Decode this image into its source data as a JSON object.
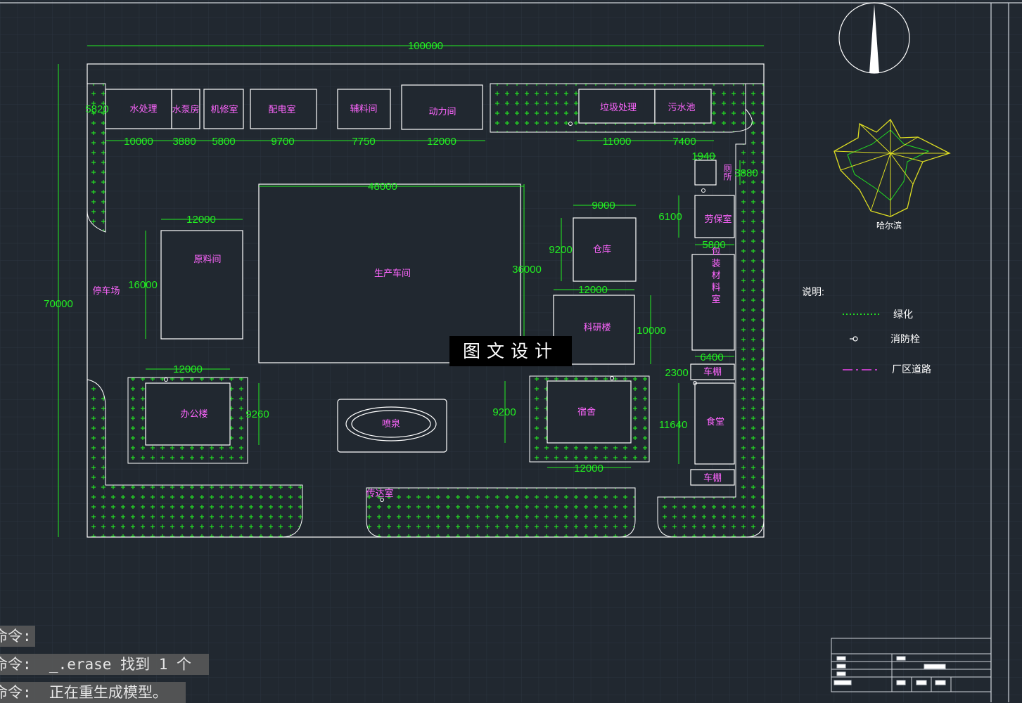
{
  "drawing": {
    "colors": {
      "background": "#212830",
      "grid": "#2a333d",
      "outline": "#ffffff",
      "dimension": "#22ee22",
      "label": "#ff66ff",
      "greenery": "#22dd22",
      "wind_rose_fill": "#dddd22",
      "road_line": "#ee44ee"
    },
    "overall_dimensions": {
      "width": "100000",
      "height": "70000"
    },
    "buildings": [
      {
        "id": "water-treatment",
        "label": "水处理",
        "dim": "10000"
      },
      {
        "id": "pump-room",
        "label": "水泵房",
        "dim": "3880"
      },
      {
        "id": "repair-room",
        "label": "机修室",
        "dim": "5800"
      },
      {
        "id": "power-room",
        "label": "配电室",
        "dim": "9700"
      },
      {
        "id": "aux-material",
        "label": "辅料间",
        "dim": "7750"
      },
      {
        "id": "power-station",
        "label": "动力间",
        "dim": "12000"
      },
      {
        "id": "garbage",
        "label": "垃圾处理",
        "dim": "11000"
      },
      {
        "id": "sewage",
        "label": "污水池",
        "dim": "7400"
      },
      {
        "id": "production",
        "label": "生产车间",
        "dim_w": "48000",
        "dim_h": "36000"
      },
      {
        "id": "raw-material",
        "label": "原料间",
        "dim_w": "12000",
        "dim_h": "16000"
      },
      {
        "id": "warehouse",
        "label": "仓库",
        "dim_w": "9000",
        "dim_h": "9200"
      },
      {
        "id": "research",
        "label": "科研楼",
        "dim_w": "12000",
        "dim_h": "10000"
      },
      {
        "id": "office",
        "label": "办公楼",
        "dim_w": "12000",
        "dim_h": "9260"
      },
      {
        "id": "fountain",
        "label": "喷泉"
      },
      {
        "id": "dormitory",
        "label": "宿舍",
        "dim_w": "12000",
        "dim_h": "9200"
      },
      {
        "id": "toilet",
        "label": "厕所",
        "dim_w": "1940",
        "dim_h": "3880"
      },
      {
        "id": "labor-room",
        "label": "劳保室",
        "dim_w": "5800",
        "dim_h": "6100"
      },
      {
        "id": "packaging",
        "label": "包装材料室",
        "dim": "6400"
      },
      {
        "id": "shed-1",
        "label": "车棚",
        "dim": "2300"
      },
      {
        "id": "canteen",
        "label": "食堂",
        "dim": "11640"
      },
      {
        "id": "shed-2",
        "label": "车棚"
      },
      {
        "id": "guard-room",
        "label": "传达室"
      },
      {
        "id": "parking",
        "label": "停车场"
      }
    ],
    "dimension_extra": {
      "top_left_height": "5820"
    },
    "wind_rose_label": "哈尔滨",
    "legend": {
      "title": "说明:",
      "items": [
        {
          "name": "greenery",
          "label": "绿化"
        },
        {
          "name": "hydrant",
          "label": "消防栓"
        },
        {
          "name": "road",
          "label": "厂区道路"
        }
      ]
    },
    "watermark": "图文设计"
  },
  "command_line": {
    "lines": [
      "命令:",
      "命令:  _.erase 找到 1 个",
      "命令:  正在重生成模型。"
    ]
  }
}
